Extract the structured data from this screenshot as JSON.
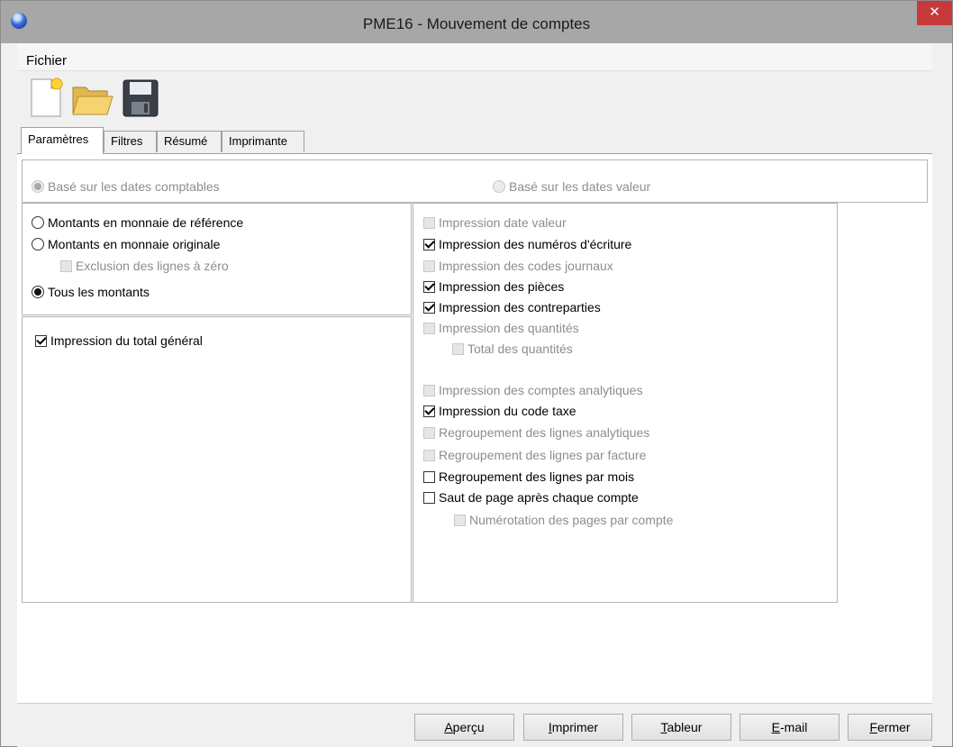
{
  "window": {
    "title": "PME16 - Mouvement de comptes",
    "close_glyph": "✕"
  },
  "menu": {
    "file": "Fichier"
  },
  "toolbar": {
    "icons": [
      "new-document-icon",
      "open-folder-icon",
      "save-icon"
    ]
  },
  "tabs": [
    "Paramètres",
    "Filtres",
    "Résumé",
    "Imprimante"
  ],
  "date_basis": {
    "accounting": {
      "label": "Basé sur les dates comptables",
      "selected": true,
      "disabled": true
    },
    "value": {
      "label": "Basé sur les dates valeur",
      "selected": false,
      "disabled": true
    }
  },
  "amounts": {
    "reference": {
      "label": "Montants en monnaie de référence",
      "selected": false
    },
    "original": {
      "label": "Montants en monnaie originale",
      "selected": false
    },
    "exclude_zero": {
      "label": "Exclusion des lignes à zéro",
      "checked": false,
      "disabled": true
    },
    "all": {
      "label": "Tous les montants",
      "selected": true
    }
  },
  "totals": {
    "grand_total": {
      "label": "Impression du total général",
      "checked": true
    }
  },
  "print_options": [
    {
      "label": "Impression date valeur",
      "checked": false,
      "disabled": true
    },
    {
      "label": "Impression des numéros d'écriture",
      "checked": true,
      "disabled": false
    },
    {
      "label": "Impression des codes journaux",
      "checked": false,
      "disabled": true
    },
    {
      "label": "Impression des pièces",
      "checked": true,
      "disabled": false
    },
    {
      "label": "Impression des contreparties",
      "checked": true,
      "disabled": false
    },
    {
      "label": "Impression des quantités",
      "checked": false,
      "disabled": true
    },
    {
      "label": "Total des quantités",
      "checked": false,
      "disabled": true
    },
    {
      "label": "Impression des comptes analytiques",
      "checked": false,
      "disabled": true
    },
    {
      "label": "Impression du code taxe",
      "checked": true,
      "disabled": false
    },
    {
      "label": "Regroupement des lignes analytiques",
      "checked": false,
      "disabled": true
    },
    {
      "label": "Regroupement des lignes par facture",
      "checked": false,
      "disabled": true
    },
    {
      "label": "Regroupement des lignes par mois",
      "checked": false,
      "disabled": false
    },
    {
      "label": "Saut de page après chaque compte",
      "checked": false,
      "disabled": false
    },
    {
      "label": "Numérotation des pages par compte",
      "checked": false,
      "disabled": true
    }
  ],
  "buttons": {
    "preview": "Aperçu",
    "print": "Imprimer",
    "spreadsheet": "Tableur",
    "email": "E-mail",
    "close": "Fermer"
  }
}
